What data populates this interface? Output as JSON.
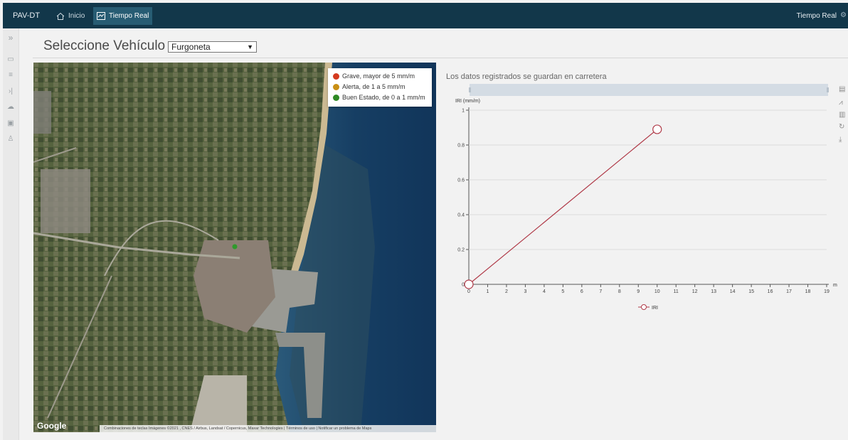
{
  "app": {
    "brand": "PAV-DT"
  },
  "nav": {
    "home_label": "Inicio",
    "realtime_label": "Tiempo Real",
    "right_label": "Tiempo Real"
  },
  "sidebar": {
    "icons": [
      "chevron-double-right-icon",
      "calendar-icon",
      "filter-icon",
      "arrow-right-bar-icon",
      "upload-cloud-icon",
      "chip-icon",
      "person-icon"
    ]
  },
  "header": {
    "title": "Seleccione Vehículo"
  },
  "vehicle": {
    "selected": "Furgoneta"
  },
  "map": {
    "legend": [
      {
        "label": "Grave, mayor de 5 mm/m",
        "color": "#d43a1f"
      },
      {
        "label": "Alerta, de 1 a 5 mm/m",
        "color": "#c98f14"
      },
      {
        "label": "Buen Estado, de 0 a 1 mm/m",
        "color": "#2f8a24"
      }
    ],
    "brand": "Google",
    "footer": "Combinaciones de teclas   Imágenes ©2021 , CNES / Airbus, Landsat / Copernicus, Maxar Technologies  |  Términos de uso  |  Notificar un problema de Maps"
  },
  "chart": {
    "caption": "Los datos registrados se guardan en carretera",
    "tools": [
      "data-view-icon",
      "line-chart-icon",
      "bar-chart-icon",
      "restore-icon",
      "download-icon"
    ]
  },
  "chart_data": {
    "type": "line",
    "ylabel": "IRI (mm/m)",
    "xlabel": "m",
    "xlim": [
      0,
      19
    ],
    "ylim": [
      0,
      1
    ],
    "x_ticks": [
      "0",
      "1",
      "2",
      "3",
      "4",
      "5",
      "6",
      "7",
      "8",
      "9",
      "10",
      "11",
      "12",
      "13",
      "14",
      "15",
      "16",
      "17",
      "18",
      "19"
    ],
    "y_ticks": [
      "0",
      "0.2",
      "0.4",
      "0.6",
      "0.8",
      "1"
    ],
    "series": [
      {
        "name": "IRI",
        "color": "#b03a48",
        "points": [
          {
            "x": 0,
            "y": 0
          },
          {
            "x": 10,
            "y": 0.89
          }
        ]
      }
    ],
    "grid": true,
    "legend_position": "bottom"
  }
}
